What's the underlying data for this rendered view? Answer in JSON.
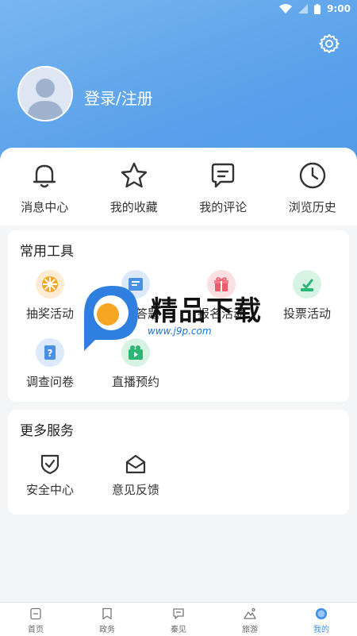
{
  "status_bar": {
    "time": "9:00"
  },
  "profile": {
    "login_label": "登录/注册"
  },
  "quick_actions": [
    {
      "label": "消息中心",
      "icon": "bell-icon"
    },
    {
      "label": "我的收藏",
      "icon": "star-icon"
    },
    {
      "label": "我的评论",
      "icon": "comment-icon"
    },
    {
      "label": "浏览历史",
      "icon": "clock-icon"
    }
  ],
  "tools": {
    "title": "常用工具",
    "items": [
      {
        "label": "抽奖活动",
        "icon": "wheel-icon"
      },
      {
        "label": "我要答题",
        "icon": "quiz-icon"
      },
      {
        "label": "报名活动",
        "icon": "gift-icon"
      },
      {
        "label": "投票活动",
        "icon": "vote-icon"
      },
      {
        "label": "调查问卷",
        "icon": "survey-icon"
      },
      {
        "label": "直播预约",
        "icon": "live-icon"
      }
    ]
  },
  "services": {
    "title": "更多服务",
    "items": [
      {
        "label": "安全中心",
        "icon": "shield-icon"
      },
      {
        "label": "意见反馈",
        "icon": "mail-icon"
      }
    ]
  },
  "watermark": {
    "text": "精品下载",
    "url": "www.j9p.com"
  },
  "bottom_nav": [
    {
      "label": "首页",
      "icon": "home-icon"
    },
    {
      "label": "政务",
      "icon": "bookmark-icon"
    },
    {
      "label": "秦见",
      "icon": "chat-icon"
    },
    {
      "label": "旅游",
      "icon": "mountain-icon"
    },
    {
      "label": "我的",
      "icon": "profile-icon"
    }
  ],
  "colors": {
    "accent": "#3b8fe8",
    "header": "#5aa2ea"
  }
}
